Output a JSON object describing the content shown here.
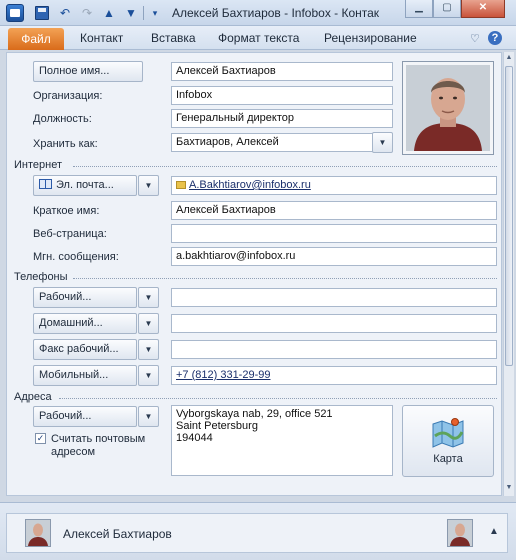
{
  "window": {
    "title": "Алексей Бахтиаров - Infobox - Контак"
  },
  "ribbon": {
    "tabs": [
      "Файл",
      "Контакт",
      "Вставка",
      "Формат текста",
      "Рецензирование"
    ]
  },
  "general": {
    "fullname_button": "Полное имя...",
    "fullname_value": "Алексей Бахтиаров",
    "company_label": "Организация:",
    "company_value": "Infobox",
    "jobtitle_label": "Должность:",
    "jobtitle_value": "Генеральный директор",
    "fileas_label": "Хранить как:",
    "fileas_value": "Бахтиаров, Алексей"
  },
  "internet": {
    "section": "Интернет",
    "email_button": "Эл. почта...",
    "email_value": "A.Bakhtiarov@infobox.ru",
    "display_label": "Краткое имя:",
    "display_value": "Алексей Бахтиаров",
    "web_label": "Веб-страница:",
    "web_value": "",
    "im_label": "Мгн. сообщения:",
    "im_value": "a.bakhtiarov@infobox.ru"
  },
  "phones": {
    "section": "Телефоны",
    "items": [
      {
        "button": "Рабочий...",
        "value": ""
      },
      {
        "button": "Домашний...",
        "value": ""
      },
      {
        "button": "Факс рабочий...",
        "value": ""
      },
      {
        "button": "Мобильный...",
        "value": "+7 (812) 331-29-99"
      }
    ]
  },
  "addresses": {
    "section": "Адреса",
    "type_button": "Рабочий...",
    "mailing_label_1": "Считать почтовым",
    "mailing_label_2": "адресом",
    "mailing_checked": true,
    "lines": [
      "Vyborgskaya nab, 29, office 521",
      "Saint Petersburg",
      "194044"
    ],
    "map_button": "Карта"
  },
  "people_pane": {
    "name": "Алексей Бахтиаров"
  },
  "colors": {
    "file_tab": "#d96b1a",
    "accent": "#2b5aa8"
  }
}
